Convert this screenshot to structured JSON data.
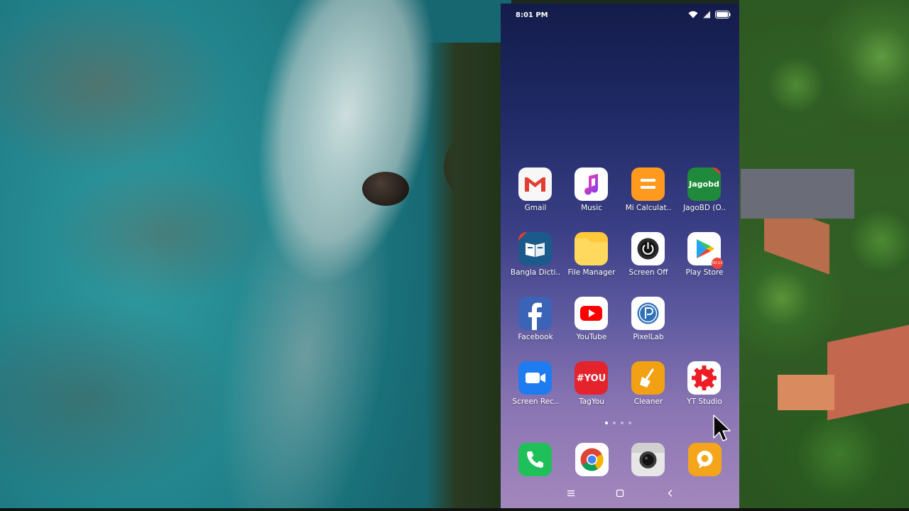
{
  "status_bar": {
    "time": "8:01 PM"
  },
  "apps": [
    {
      "label": "Gmail",
      "icon": "gmail-icon"
    },
    {
      "label": "Music",
      "icon": "music-icon"
    },
    {
      "label": "Mi Calculat..",
      "icon": "calculator-icon"
    },
    {
      "label": "JagoBD (O..",
      "icon": "jagobd-icon"
    },
    {
      "label": "Bangla Dicti..",
      "icon": "dictionary-icon"
    },
    {
      "label": "File Manager",
      "icon": "folder-icon"
    },
    {
      "label": "Screen Off",
      "icon": "power-icon"
    },
    {
      "label": "Play Store",
      "icon": "play-store-icon"
    },
    {
      "label": "Facebook",
      "icon": "facebook-icon"
    },
    {
      "label": "YouTube",
      "icon": "youtube-icon"
    },
    {
      "label": "PixelLab",
      "icon": "pixellab-icon"
    },
    {
      "label": "Screen Rec..",
      "icon": "video-camera-icon"
    },
    {
      "label": "TagYou",
      "icon": "tagyou-icon"
    },
    {
      "label": "Cleaner",
      "icon": "broom-icon"
    },
    {
      "label": "YT Studio",
      "icon": "yt-studio-icon"
    }
  ],
  "badges": {
    "play_store": "00:13"
  },
  "app_icon_text": {
    "jagobd": "Jagobd",
    "tagyou": "#YOU"
  },
  "page_indicator": {
    "pages": 4,
    "current": 1
  },
  "dock": [
    {
      "icon": "phone-icon"
    },
    {
      "icon": "chrome-icon"
    },
    {
      "icon": "camera-icon"
    },
    {
      "icon": "messages-icon"
    }
  ],
  "nav_bar": [
    "menu-icon",
    "home-icon",
    "back-icon"
  ],
  "colors": {
    "wallpaper_top": "#141c4a",
    "wallpaper_bottom": "#a387bd",
    "badge": "#f0453c"
  }
}
